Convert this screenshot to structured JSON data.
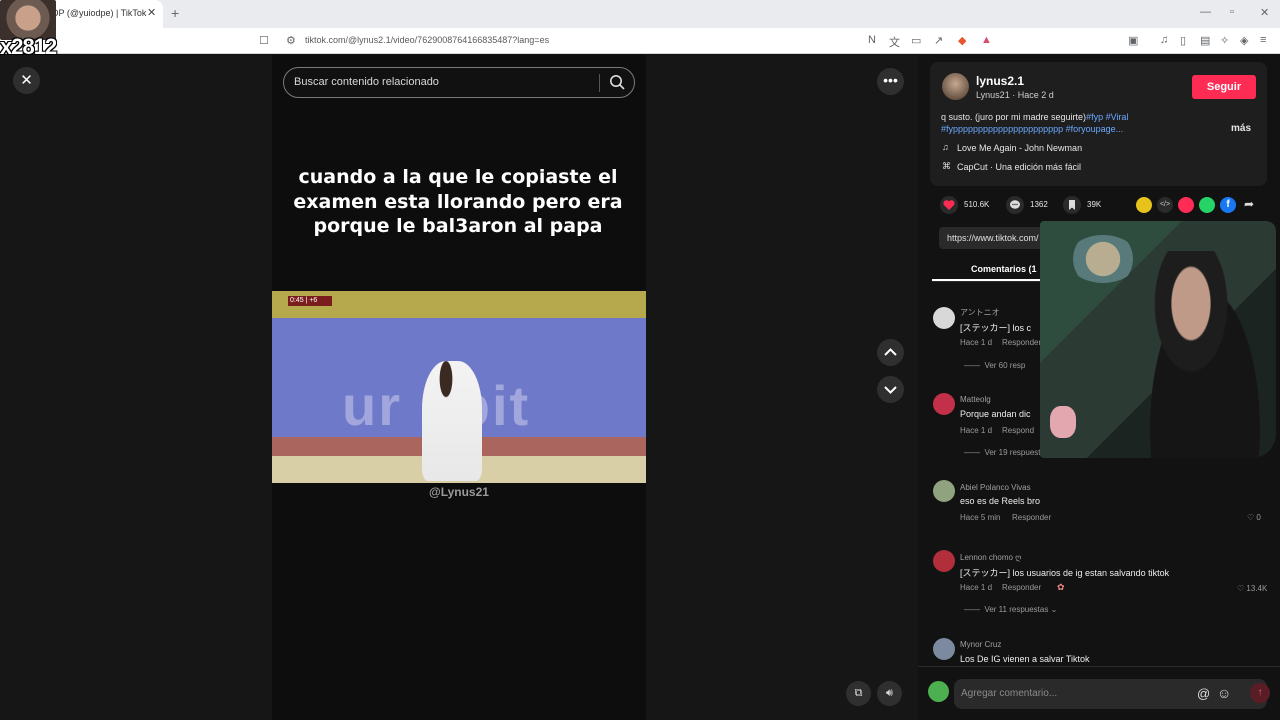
{
  "browser": {
    "tab_title": "DP (@yuiodpe) | TikTok",
    "new_tab": "+",
    "url": "tiktok.com/@lynus2.1/video/7629008764166835487?lang=es"
  },
  "overlay": {
    "count": "x2812"
  },
  "search": {
    "placeholder": "Buscar contenido relacionado"
  },
  "video": {
    "caption": "cuando a la que le copiaste el examen esta llorando pero era porque le bal3aron al papa",
    "clip_score": "0:45 | +6",
    "clip_bg_text": "ur nbit",
    "watermark": "@Lynus21"
  },
  "author": {
    "username": "lynus2.1",
    "subline": "Lynus21 · Hace 2 d",
    "follow_label": "Seguir"
  },
  "description": {
    "text_line1_plain": "q susto. (juro por mi madre seguirte)",
    "text_line1_tags": "#fyp #Viral",
    "text_line2": "#fypppppppppppppppppppppp #foryoupage...",
    "more": "más",
    "music": "Love Me Again - John Newman",
    "capcut": "CapCut · Una edición más fácil"
  },
  "stats": {
    "likes": "510.6K",
    "comments": "1362",
    "saves": "39K"
  },
  "link_text": "https://www.tiktok.com/",
  "comments_tab": "Comentarios (1",
  "comments": [
    {
      "user": "アントニオ",
      "text": "[ステッカー] los c",
      "time": "Hace 1 d",
      "reply": "Responder",
      "replies": "Ver 60 resp",
      "likes": ""
    },
    {
      "user": "Matteolg",
      "text": "Porque andan dic",
      "time": "Hace 1 d",
      "reply": "Respond",
      "replies": "Ver 19 respuestas",
      "likes": ""
    },
    {
      "user": "Abiel Polanco Vivas",
      "text": "eso es de Reels bro",
      "time": "Hace 5 min",
      "reply": "Responder",
      "replies": "",
      "likes": "0"
    },
    {
      "user": "Lennon chomo ღ",
      "text": "[ステッカー] los usuarios de ig estan salvando tiktok",
      "time": "Hace 1 d",
      "reply": "Responder",
      "replies": "Ver 11 respuestas",
      "likes": "13.4K"
    },
    {
      "user": "Mynor Cruz",
      "text": "Los De IG vienen a salvar Tiktok",
      "time": "",
      "reply": "",
      "replies": "",
      "likes": ""
    }
  ],
  "comment_input": {
    "placeholder": "Agregar comentario...",
    "at": "@",
    "emoji": "☺"
  },
  "icons": {
    "close": "close-icon",
    "more": "more-icon",
    "up": "chevron-up-icon",
    "down": "chevron-down-icon",
    "search": "search-icon",
    "heart": "heart-icon",
    "comment": "comment-icon",
    "bookmark": "bookmark-icon",
    "music": "music-note-icon",
    "capcut": "capcut-icon",
    "send": "send-icon"
  },
  "colors": {
    "accent": "#fe2c55",
    "link": "#6aa8ff",
    "panel": "#121212"
  }
}
